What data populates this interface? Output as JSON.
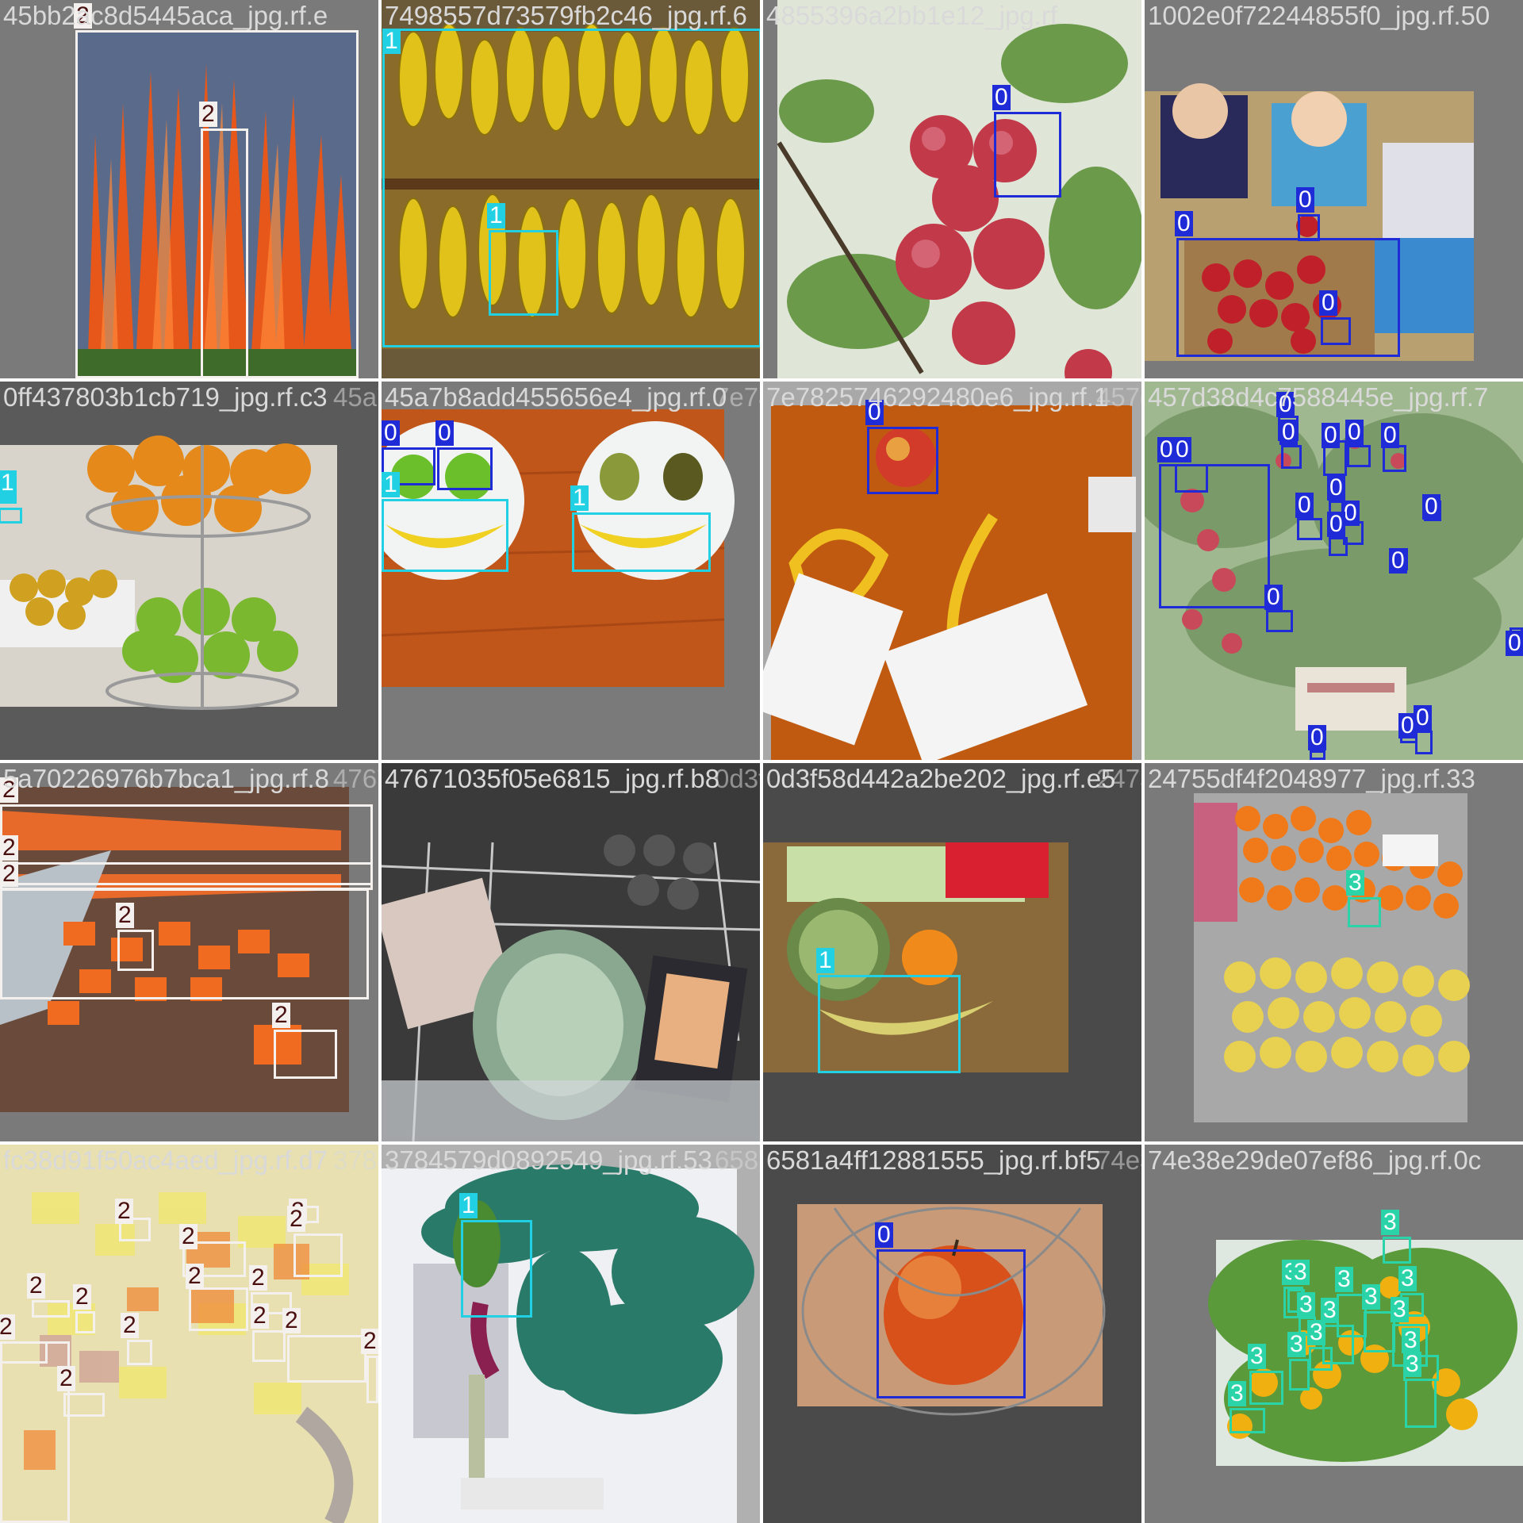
{
  "mosaic": {
    "tiles": [
      {
        "name": "45bb2ac8d5445aca_jpg.rf.e",
        "ghost": "7498557d73579fb2c46_jpg.rf.6"
      },
      {
        "name": "7498557d73579fb2c46_jpg.rf.6",
        "ghost": "4855396a2bb1e12_jpg.rf"
      },
      {
        "name": "4855396a2bb1e12_jpg.rf",
        "ghost": "1002e0f72244855f0_jpg.rf.5"
      },
      {
        "name": "1002e0f72244855f0_jpg.rf.50",
        "ghost": ""
      },
      {
        "name": "0ff437803b1cb719_jpg.rf.c3",
        "ghost": "45a7b8add455656e4_jpg.rf.0"
      },
      {
        "name": "45a7b8add455656e4_jpg.rf.0",
        "ghost": "7e7825746292480e6_jpg.rf.1"
      },
      {
        "name": "7e7825746292480e6_jpg.rf.1",
        "ghost": "457d38d4c7588445e_jpg.rf.7"
      },
      {
        "name": "457d38d4c7588445e_jpg.rf.7",
        "ghost": ""
      },
      {
        "name": "5a70226976b7bca1_jpg.rf.8",
        "ghost": "47671035f05e6815_jpg.rf.b8"
      },
      {
        "name": "47671035f05e6815_jpg.rf.b8",
        "ghost": "0d3f58d442a2be202_jpg.rf.e5"
      },
      {
        "name": "0d3f58d442a2be202_jpg.rf.e5",
        "ghost": "24755df4f2048977_jpg.rf.33"
      },
      {
        "name": "24755df4f2048977_jpg.rf.33",
        "ghost": ""
      },
      {
        "name": "fc38d91f50ac4aed_jpg.rf.d7",
        "ghost": "3784579d0892549_jpg.rf.53"
      },
      {
        "name": "3784579d0892549_jpg.rf.53",
        "ghost": "6581a4ff12881555_jpg.rf.bf5"
      },
      {
        "name": "6581a4ff12881555_jpg.rf.bf5",
        "ghost": "74e38e29de07ef86_jpg.rf.0"
      },
      {
        "name": "74e38e29de07ef86_jpg.rf.0c",
        "ghost": ""
      }
    ]
  },
  "colors": {
    "class0": "#1f2bd6",
    "class1": "#22d0e3",
    "class2": "#f4f0ee",
    "class3": "#2bd4a8",
    "label_text": "#ffffff",
    "filename_text": "#d9d9d9"
  },
  "labels": {
    "c0": "0",
    "c1": "1",
    "c2": "2",
    "c3": "3"
  }
}
